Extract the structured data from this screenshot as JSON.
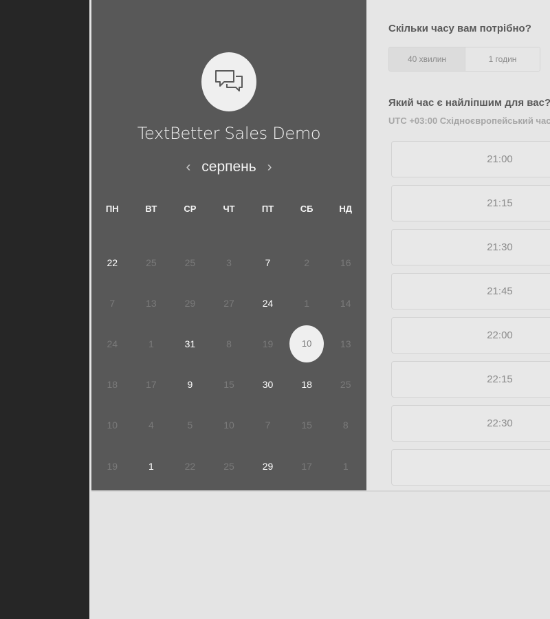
{
  "widget": {
    "title": "TextBetter Sales Demo",
    "logo_icon": "chat-bubbles-icon"
  },
  "calendar": {
    "month": "серпень",
    "prev_icon": "chevron-left-icon",
    "next_icon": "chevron-right-icon",
    "weekdays": [
      "ПН",
      "ВТ",
      "СР",
      "ЧТ",
      "ПТ",
      "СБ",
      "НД"
    ],
    "weeks": [
      [
        {
          "label": "22",
          "active": true
        },
        {
          "label": "25",
          "active": false
        },
        {
          "label": "25",
          "active": false
        },
        {
          "label": "3",
          "active": false
        },
        {
          "label": "7",
          "active": true
        },
        {
          "label": "2",
          "active": false
        },
        {
          "label": "16",
          "active": false
        }
      ],
      [
        {
          "label": "7",
          "active": false
        },
        {
          "label": "13",
          "active": false
        },
        {
          "label": "29",
          "active": false
        },
        {
          "label": "27",
          "active": false
        },
        {
          "label": "24",
          "active": true
        },
        {
          "label": "1",
          "active": false
        },
        {
          "label": "14",
          "active": false
        }
      ],
      [
        {
          "label": "24",
          "active": false
        },
        {
          "label": "1",
          "active": false
        },
        {
          "label": "31",
          "active": true
        },
        {
          "label": "8",
          "active": false
        },
        {
          "label": "19",
          "active": false
        },
        {
          "label": "10",
          "active": true,
          "selected": true
        },
        {
          "label": "13",
          "active": false
        }
      ],
      [
        {
          "label": "18",
          "active": false
        },
        {
          "label": "17",
          "active": false
        },
        {
          "label": "9",
          "active": true
        },
        {
          "label": "15",
          "active": false
        },
        {
          "label": "30",
          "active": true
        },
        {
          "label": "18",
          "active": true
        },
        {
          "label": "25",
          "active": false
        }
      ],
      [
        {
          "label": "10",
          "active": false
        },
        {
          "label": "4",
          "active": false
        },
        {
          "label": "5",
          "active": false
        },
        {
          "label": "10",
          "active": false
        },
        {
          "label": "7",
          "active": false
        },
        {
          "label": "15",
          "active": false
        },
        {
          "label": "8",
          "active": false
        }
      ],
      [
        {
          "label": "19",
          "active": false
        },
        {
          "label": "1",
          "active": true
        },
        {
          "label": "22",
          "active": false
        },
        {
          "label": "25",
          "active": false
        },
        {
          "label": "29",
          "active": true
        },
        {
          "label": "17",
          "active": false
        },
        {
          "label": "1",
          "active": false
        }
      ]
    ]
  },
  "booking": {
    "duration_question": "Скільки часу вам потрібно?",
    "durations": [
      {
        "label": "40 хвилин",
        "selected": true
      },
      {
        "label": "1 годин",
        "selected": false
      }
    ],
    "time_question": "Який час є найліпшим для вас?",
    "timezone": "UTC +03:00 Східноєвропейський час",
    "slots": [
      "21:00",
      "21:15",
      "21:30",
      "21:45",
      "22:00",
      "22:15",
      "22:30",
      ""
    ]
  }
}
